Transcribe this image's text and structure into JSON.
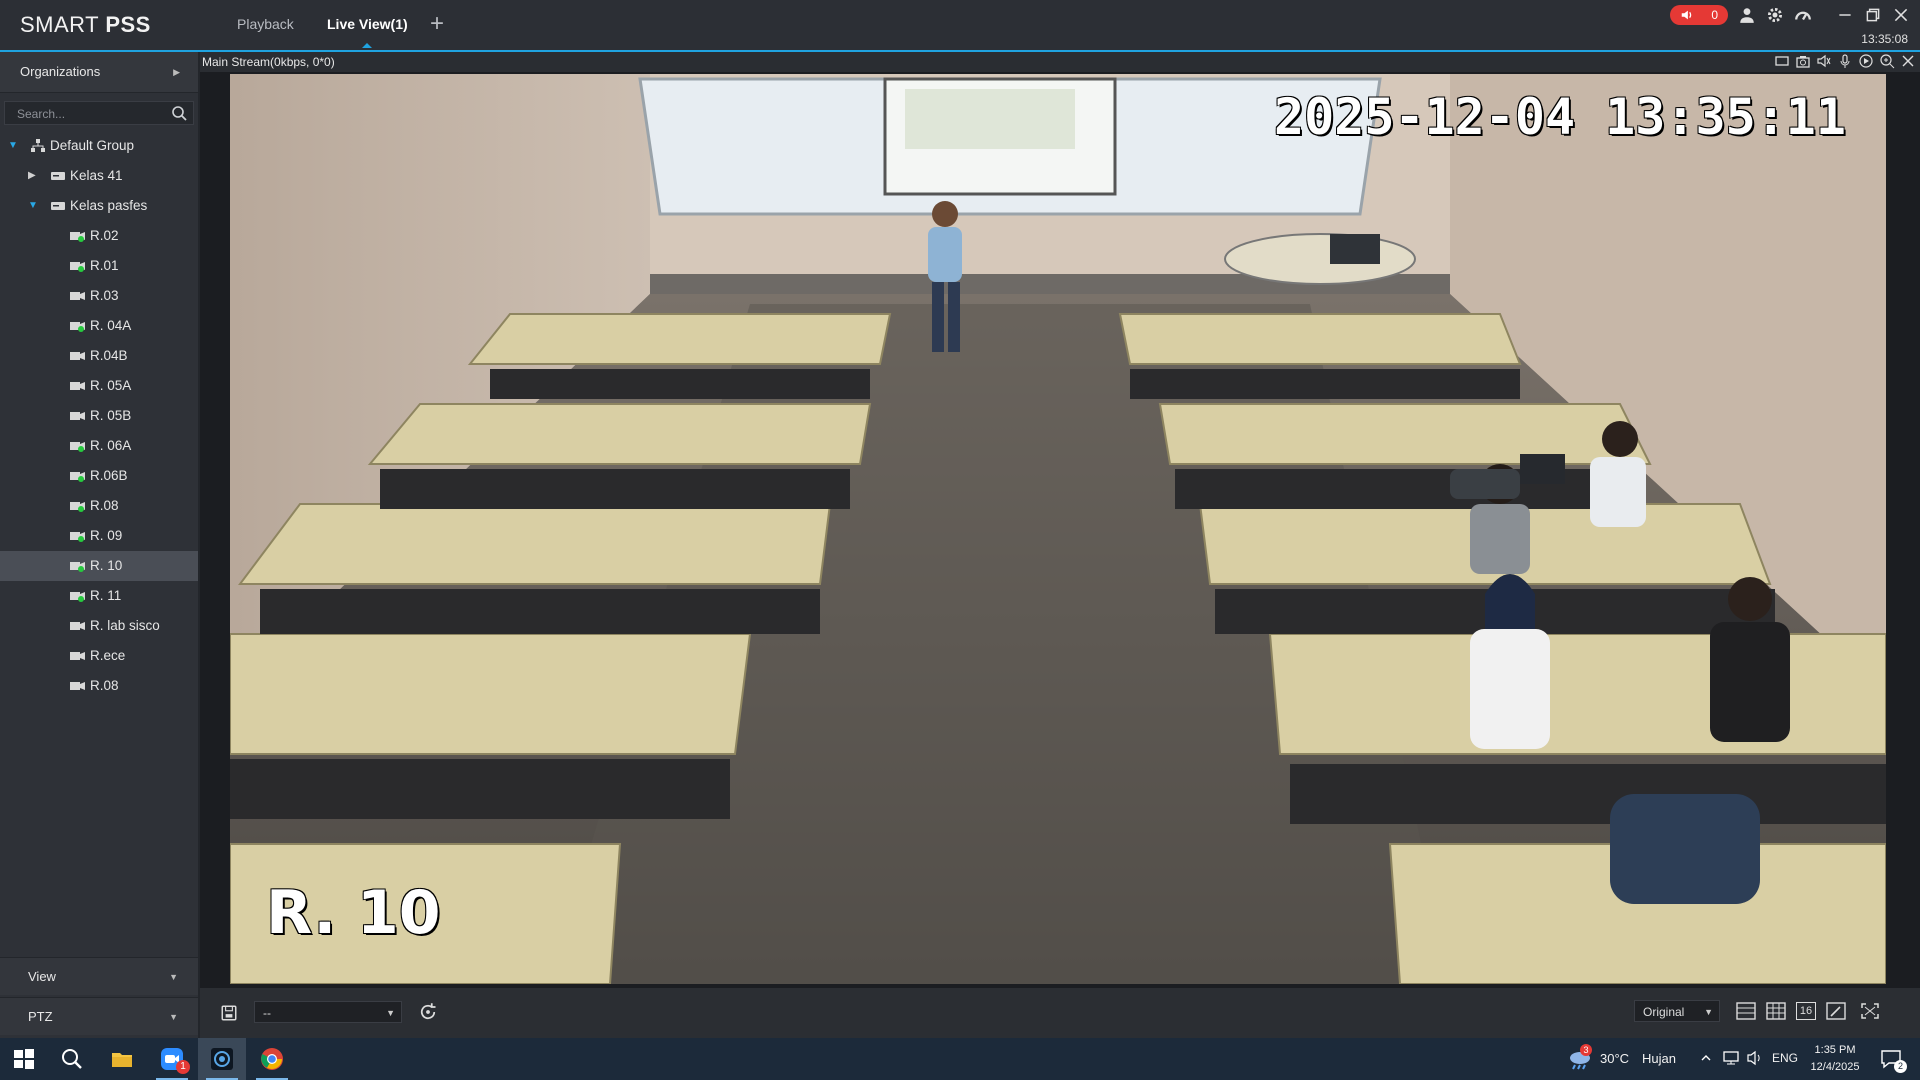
{
  "app": {
    "brand_prefix": "SMART ",
    "brand_suffix": "PSS",
    "tabs": [
      {
        "label": "Playback",
        "active": false
      },
      {
        "label": "Live View(1)",
        "active": true
      }
    ],
    "alarm_count": "0",
    "clock": "13:35:08",
    "accent_color": "#1fa3e0",
    "alarm_color": "#e53935"
  },
  "sidebar": {
    "organizations_label": "Organizations",
    "search_placeholder": "Search...",
    "root_group": "Default Group",
    "groups": [
      {
        "label": "Kelas 41",
        "expanded": false
      },
      {
        "label": "Kelas pasfes",
        "expanded": true
      }
    ],
    "cameras": [
      {
        "label": "R.02",
        "online": true
      },
      {
        "label": "R.01",
        "online": true
      },
      {
        "label": "R.03",
        "online": false
      },
      {
        "label": "R. 04A",
        "online": true
      },
      {
        "label": "R.04B",
        "online": false
      },
      {
        "label": "R. 05A",
        "online": false
      },
      {
        "label": "R. 05B",
        "online": false
      },
      {
        "label": "R. 06A",
        "online": true
      },
      {
        "label": "R.06B",
        "online": true
      },
      {
        "label": "R.08",
        "online": true
      },
      {
        "label": "R. 09",
        "online": true
      },
      {
        "label": "R. 10",
        "online": true,
        "selected": true
      },
      {
        "label": "R. 11",
        "online": true
      },
      {
        "label": "R. lab sisco",
        "online": false
      },
      {
        "label": "R.ece",
        "online": false
      },
      {
        "label": "R.08",
        "online": false
      }
    ],
    "view_label": "View",
    "ptz_label": "PTZ"
  },
  "video": {
    "stream_info": "Main Stream(0kbps, 0*0)",
    "osd_timestamp": "2025-12-04 13:35:11",
    "osd_channel": "R. 10",
    "toolbar_icons": [
      "ratio-icon",
      "snapshot-icon",
      "audio-icon",
      "talk-icon",
      "record-icon",
      "zoom-icon",
      "close-icon"
    ]
  },
  "bottom_toolbar": {
    "view_select_value": "--",
    "scale_select_value": "Original",
    "layout_icons": [
      "layout-1-icon",
      "layout-4-icon",
      "layout-16-icon",
      "custom-layout-icon",
      "fullscreen-icon"
    ],
    "layout_16_label": "16"
  },
  "taskbar": {
    "temperature": "30°C",
    "weather": "Hujan",
    "language": "ENG",
    "time": "1:35 PM",
    "date": "12/4/2025",
    "weather_badge": "3",
    "notification_count": "2",
    "zoom_badge": "1"
  }
}
